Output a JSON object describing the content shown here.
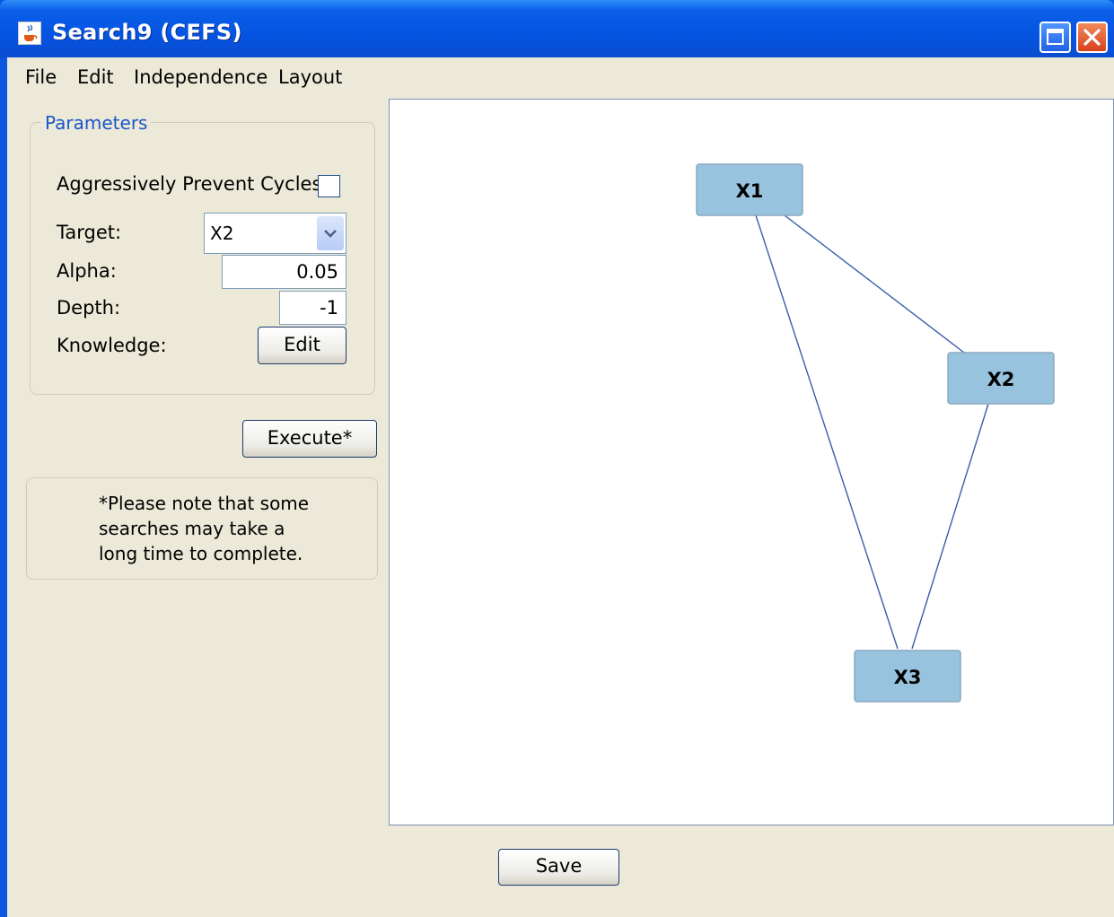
{
  "window": {
    "title": "Search9 (CEFS)",
    "icon": "java-cup-icon",
    "controls": [
      "maximize-icon",
      "close-icon"
    ]
  },
  "menu": {
    "items": [
      "File",
      "Edit",
      "Independence",
      "Layout"
    ]
  },
  "parameters": {
    "legend": "Parameters",
    "prevent_cycles_label": "Aggressively Prevent Cycles:",
    "prevent_cycles_checked": false,
    "target_label": "Target:",
    "target_value": "X2",
    "alpha_label": "Alpha:",
    "alpha_value": "0.05",
    "depth_label": "Depth:",
    "depth_value": "-1",
    "knowledge_label": "Knowledge:",
    "knowledge_button": "Edit"
  },
  "execute_button": "Execute*",
  "note": {
    "lines": [
      "*Please note that some",
      "searches may take a",
      "long time to complete."
    ]
  },
  "graph": {
    "nodes": [
      "X1",
      "X2",
      "X3"
    ],
    "edges": [
      [
        "X1",
        "X2"
      ],
      [
        "X1",
        "X3"
      ],
      [
        "X2",
        "X3"
      ]
    ],
    "node_fill": "#98c3df",
    "edge_color": "#3a5da8"
  },
  "save_button": "Save"
}
